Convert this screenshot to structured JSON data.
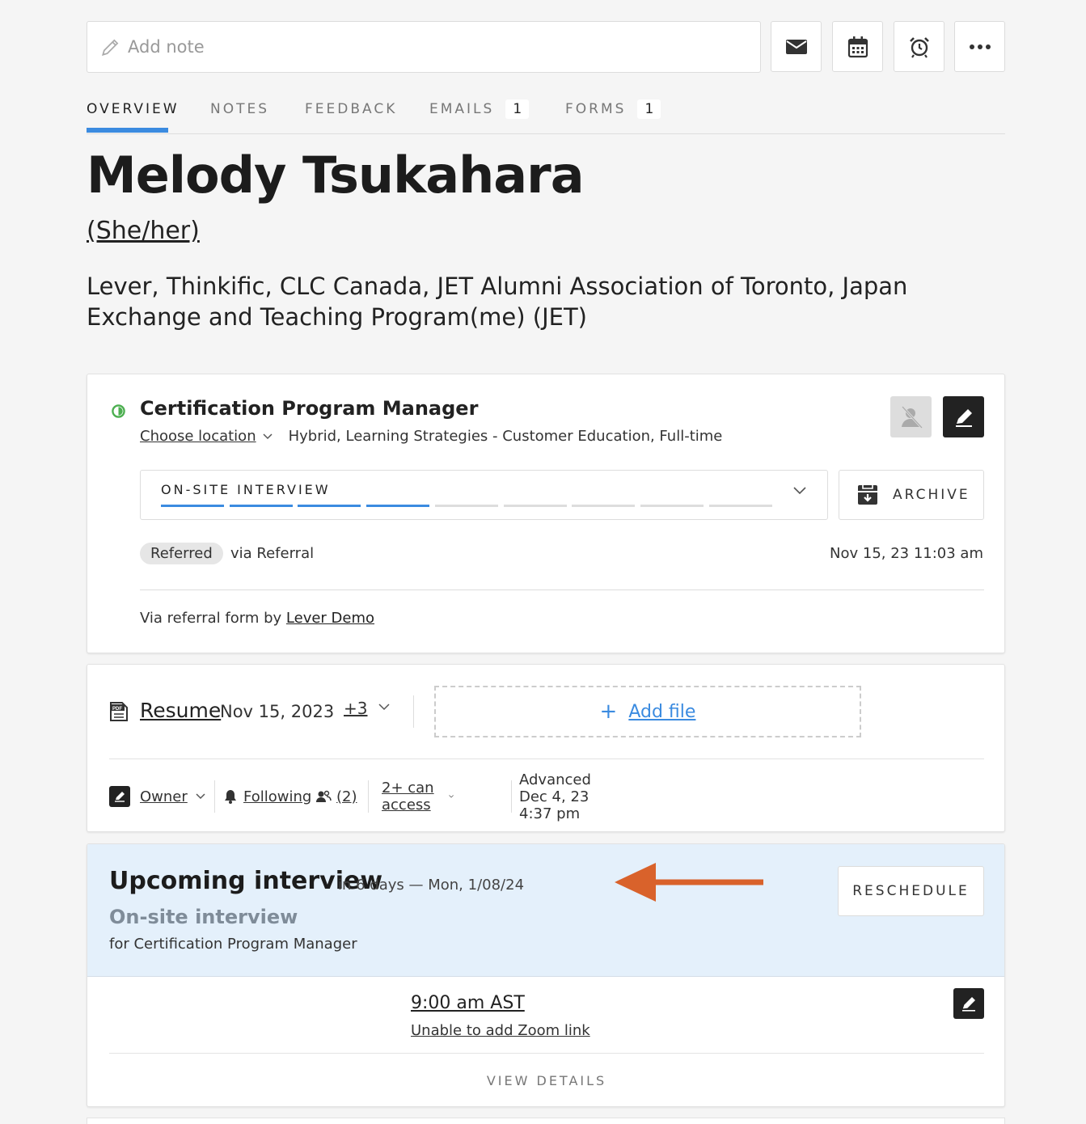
{
  "toolbar": {
    "note_placeholder": "Add note",
    "icons": [
      "pencil-icon",
      "mail-icon",
      "calendar-icon",
      "alarm-clock-icon",
      "more-icon"
    ]
  },
  "tabs": [
    {
      "label": "OVERVIEW",
      "active": true
    },
    {
      "label": "NOTES"
    },
    {
      "label": "FEEDBACK"
    },
    {
      "label": "EMAILS",
      "count": "1"
    },
    {
      "label": "FORMS",
      "count": "1"
    }
  ],
  "candidate": {
    "name": "Melody Tsukahara",
    "pronouns": "(She/her)",
    "orgs": "Lever, Thinkific, CLC Canada, JET Alumni Association of Toronto, Japan Exchange and Teaching Program(me) (JET)"
  },
  "opportunity": {
    "title": "Certification Program Manager",
    "choose_location": "Choose location",
    "details": "Hybrid, Learning Strategies - Customer Education, Full-time",
    "stage": "ON-SITE INTERVIEW",
    "stage_progress": {
      "completed": 4,
      "total": 9
    },
    "archive_label": "ARCHIVE",
    "source_badge": "Referred",
    "source_via": "via Referral",
    "source_date": "Nov 15, 23 11:03 am",
    "referral_prefix": "Via referral form by",
    "referral_by": "Lever Demo",
    "status_color": "#4caf50"
  },
  "resume": {
    "label": "Resume",
    "date": "Nov 15, 2023",
    "more": "+3",
    "add_file": "Add file",
    "owner": "Owner",
    "following": "Following",
    "followers": "(2)",
    "access": "2+ can access",
    "advanced": "Advanced Dec 4, 23 4:37 pm"
  },
  "interview": {
    "title": "Upcoming interview",
    "when": "in 6 days — Mon, 1/08/24",
    "type": "On-site interview",
    "for": "for Certification Program Manager",
    "reschedule": "RESCHEDULE",
    "time": "9:00 am AST",
    "zoom": "Unable to add Zoom link",
    "view_details": "VIEW DETAILS",
    "arrow_color": "#d9622b"
  },
  "colors": {
    "accent": "#3b8be0",
    "interview_bg": "#e4f0fb"
  }
}
